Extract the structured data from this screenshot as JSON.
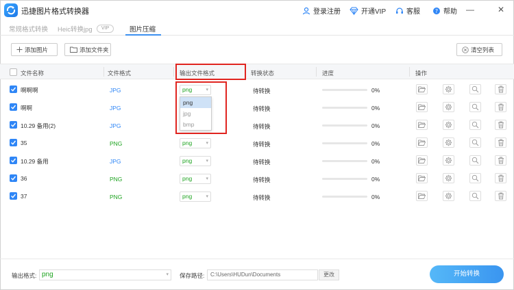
{
  "app": {
    "title": "迅捷图片格式转换器",
    "login": "登录注册",
    "vip": "开通VIP",
    "service": "客服",
    "help": "帮助",
    "minimize": "—",
    "close": "✕"
  },
  "tabs": [
    {
      "label": "常规格式转换"
    },
    {
      "label": "Heic转换jpg"
    },
    {
      "label": "图片压缩"
    }
  ],
  "vip_badge": "VIP",
  "toolbar": {
    "add_image": "添加图片",
    "add_folder": "添加文件夹",
    "clear_list": "清空列表"
  },
  "table": {
    "headers": {
      "name": "文件名称",
      "format": "文件格式",
      "output": "输出文件格式",
      "status": "转换状态",
      "progress": "进度",
      "actions": "操作"
    },
    "rows": [
      {
        "name": "啊啊啊",
        "format": "JPG",
        "format_color": "blue",
        "output": "png",
        "status": "待转换",
        "progress": "0%"
      },
      {
        "name": "啊啊",
        "format": "JPG",
        "format_color": "blue",
        "output": "png",
        "status": "待转换",
        "progress": "0%"
      },
      {
        "name": "10.29 备用(2)",
        "format": "JPG",
        "format_color": "blue",
        "output": "png",
        "status": "待转换",
        "progress": "0%"
      },
      {
        "name": "35",
        "format": "PNG",
        "format_color": "green",
        "output": "png",
        "status": "待转换",
        "progress": "0%"
      },
      {
        "name": "10.29 备用",
        "format": "JPG",
        "format_color": "blue",
        "output": "png",
        "status": "待转换",
        "progress": "0%"
      },
      {
        "name": "36",
        "format": "PNG",
        "format_color": "green",
        "output": "png",
        "status": "待转换",
        "progress": "0%"
      },
      {
        "name": "37",
        "format": "PNG",
        "format_color": "green",
        "output": "png",
        "status": "待转换",
        "progress": "0%"
      }
    ]
  },
  "dropdown": {
    "options": [
      "png",
      "jpg",
      "bmp"
    ],
    "selected": "png"
  },
  "bottom": {
    "output_format_label": "输出格式:",
    "output_format_value": "png",
    "save_path_label": "保存路径:",
    "save_path_value": "C:\\Users\\HUDun\\Documents",
    "change_label": "更改",
    "start_label": "开始转换"
  },
  "colors": {
    "accent": "#2f86f6",
    "green": "#1ea320",
    "highlight_red": "#e0231e"
  }
}
